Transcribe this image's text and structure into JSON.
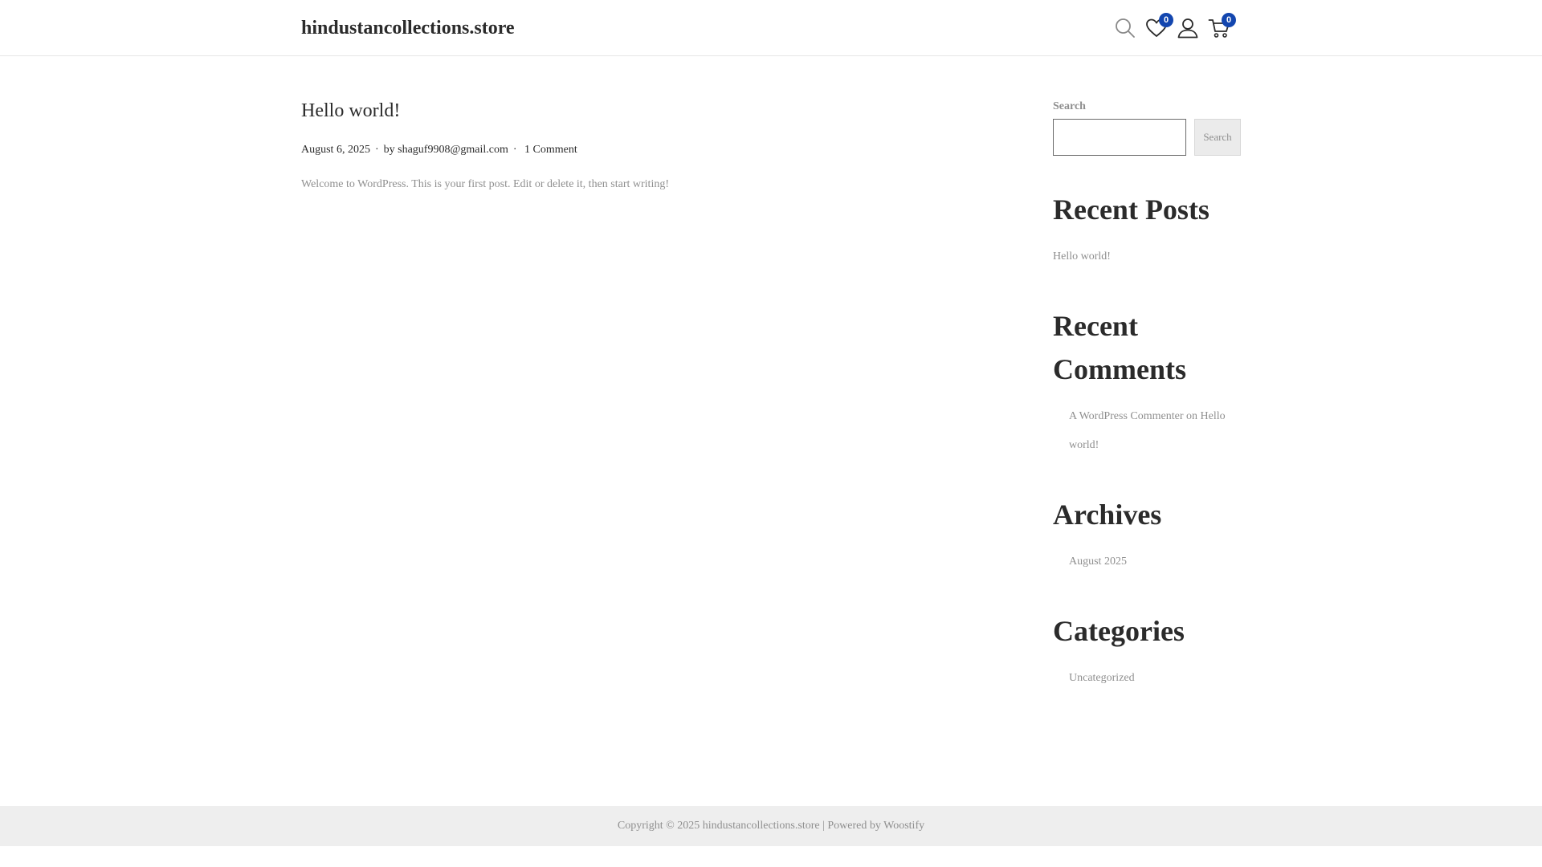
{
  "header": {
    "site_title": "hindustancollections.store",
    "icons": {
      "search": "search-icon",
      "wishlist": "heart-icon",
      "account": "user-icon",
      "cart": "cart-icon"
    },
    "wishlist_count": "0",
    "cart_count": "0",
    "badge_color": "#1346af"
  },
  "post": {
    "title": "Hello world!",
    "date": "August 6, 2025",
    "author_prefix": "by",
    "author": "shaguf9908@gmail.com",
    "comments": "1 Comment",
    "excerpt": "Welcome to WordPress. This is your first post. Edit or delete it, then start writing!"
  },
  "sidebar": {
    "search": {
      "label": "Search",
      "value": "",
      "placeholder": "",
      "button_label": "Search"
    },
    "recent_posts": {
      "heading": "Recent Posts",
      "items": [
        "Hello world!"
      ]
    },
    "recent_comments": {
      "heading_line1": "Recent",
      "heading_line2": "Comments",
      "items": [
        {
          "author": "A WordPress Commenter",
          "connector": "on",
          "post_line1": "Hello",
          "post_line2": "world!"
        }
      ]
    },
    "archives": {
      "heading": "Archives",
      "items": [
        "August 2025"
      ]
    },
    "categories": {
      "heading": "Categories",
      "items": [
        "Uncategorized"
      ]
    }
  },
  "footer": {
    "text": "Copyright © 2025 hindustancollections.store | Powered by Woostify"
  }
}
